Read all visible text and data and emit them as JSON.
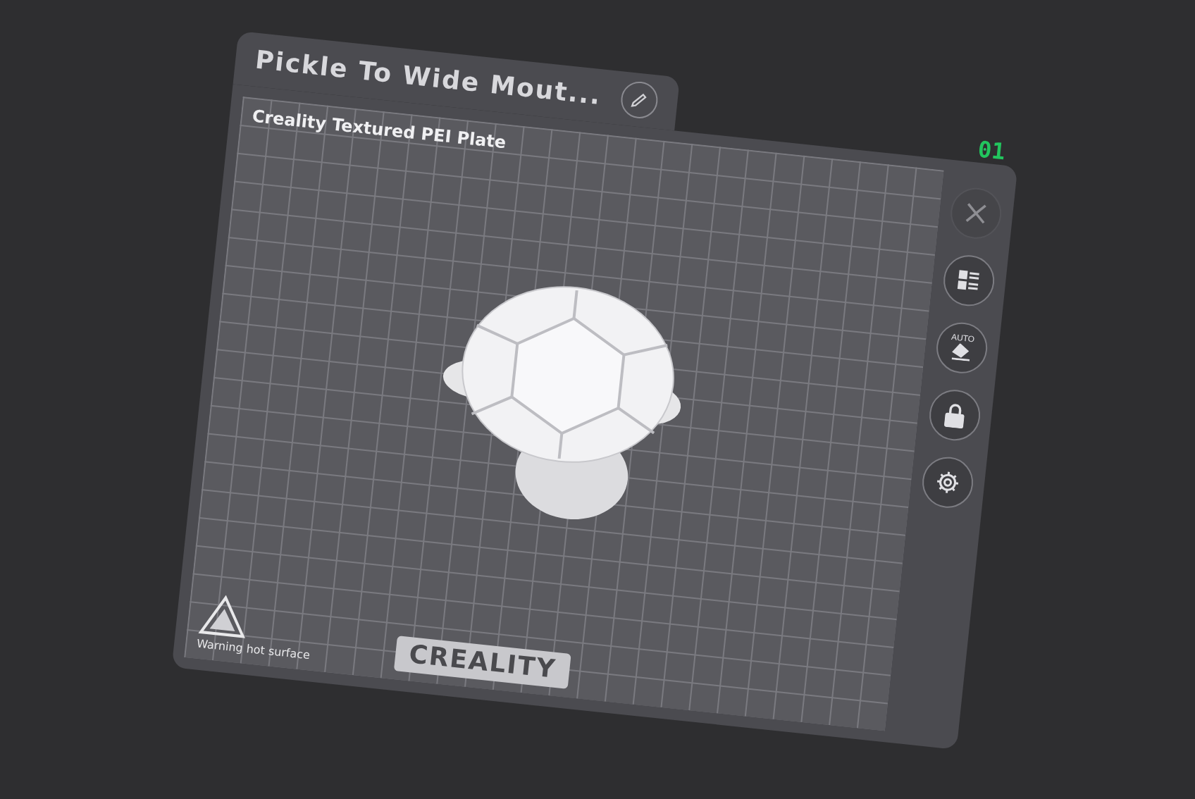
{
  "plate": {
    "name": "Pickle To Wide Mout...",
    "bed_type": "Creality Textured PEI Plate",
    "number": "01",
    "logo": "CREALITY",
    "warning": "Warning hot surface"
  },
  "tools": [
    {
      "kind": "close",
      "disabled": true
    },
    {
      "kind": "arrange",
      "disabled": false
    },
    {
      "kind": "auto",
      "label": "AUTO",
      "disabled": false
    },
    {
      "kind": "lock",
      "disabled": false
    },
    {
      "kind": "settings",
      "disabled": false
    }
  ]
}
